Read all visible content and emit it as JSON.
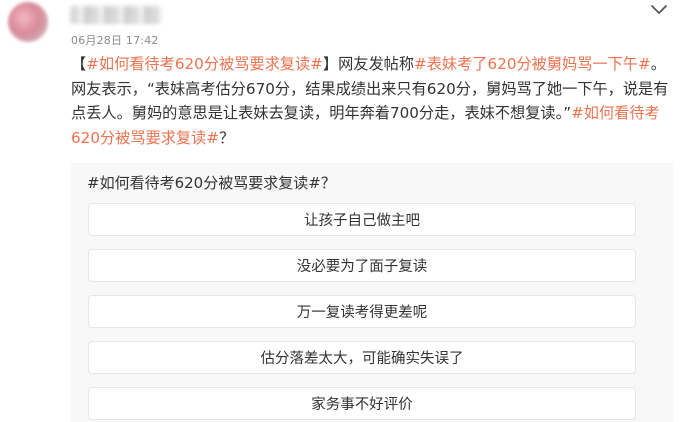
{
  "post": {
    "timestamp": "06月28日 17:42",
    "segments": [
      {
        "text": "【",
        "tag": false
      },
      {
        "text": "#如何看待考620分被骂要求复读#",
        "tag": true
      },
      {
        "text": "】网友发帖称",
        "tag": false
      },
      {
        "text": "#表妹考了620分被舅妈骂一下午#",
        "tag": true
      },
      {
        "text": "。网友表示，“表妹高考估分670分，结果成绩出来只有620分，舅妈骂了她一下午，说是有点丢人。舅妈的意思是让表妹去复读，明年奔着700分走，表妹不想复读。”",
        "tag": false
      },
      {
        "text": "#如何看待考620分被骂要求复读#",
        "tag": true
      },
      {
        "text": "？",
        "tag": false
      }
    ]
  },
  "poll": {
    "question": "#如何看待考620分被骂要求复读#？",
    "options": [
      "让孩子自己做主吧",
      "没必要为了面子复读",
      "万一复读考得更差呢",
      "估分落差太大，可能确实失误了",
      "家务事不好评价"
    ]
  },
  "icons": {
    "more": "chevron-down-icon"
  },
  "colors": {
    "topic_tag": "#eb7350",
    "poll_background": "#f8f8f8"
  }
}
